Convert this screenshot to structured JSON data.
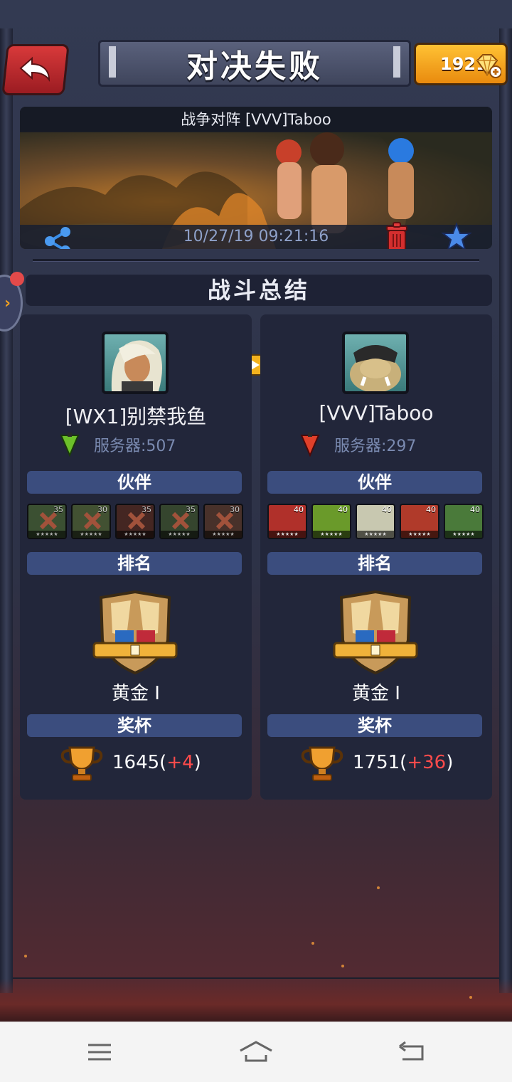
{
  "header": {
    "title": "对决失败",
    "gems": "1921"
  },
  "banner": {
    "title": "战争对阵 [VVV]Taboo",
    "timestamp": "10/27/19 09:21:16"
  },
  "summary": {
    "title": "战斗总结"
  },
  "players": [
    {
      "name": "[WX1]别禁我鱼",
      "server": "服务器:507",
      "flag_color": "#6cc02a",
      "partners_label": "伙伴",
      "heroes": [
        {
          "level": "35",
          "defeated": true,
          "color": "#3d6a2a"
        },
        {
          "level": "30",
          "defeated": true,
          "color": "#4a6a2a"
        },
        {
          "level": "35",
          "defeated": true,
          "color": "#6a2a22"
        },
        {
          "level": "35",
          "defeated": true,
          "color": "#3a5a2a"
        },
        {
          "level": "30",
          "defeated": true,
          "color": "#6a3a2a"
        }
      ],
      "rank_label": "排名",
      "rank": "黄金 I",
      "trophy_label": "奖杯",
      "trophies": "1645",
      "trophy_delta": "+4"
    },
    {
      "name": "[VVV]Taboo",
      "server": "服务器:297",
      "flag_color": "#e0402a",
      "partners_label": "伙伴",
      "heroes": [
        {
          "level": "40",
          "defeated": false,
          "color": "#b0302a"
        },
        {
          "level": "40",
          "defeated": false,
          "color": "#6a9a2a"
        },
        {
          "level": "40",
          "defeated": false,
          "color": "#c8c8b0"
        },
        {
          "level": "40",
          "defeated": false,
          "color": "#b03a2a"
        },
        {
          "level": "40",
          "defeated": false,
          "color": "#4a7a3a"
        }
      ],
      "rank_label": "排名",
      "rank": "黄金 I",
      "trophy_label": "奖杯",
      "trophies": "1751",
      "trophy_delta": "+36"
    }
  ],
  "hero_stars": "★★★★★",
  "icons": {
    "back": "back-arrow-icon",
    "gem": "gem-icon",
    "share": "share-icon",
    "delete": "trash-icon",
    "favorite": "star-icon",
    "trophy": "trophy-icon"
  }
}
